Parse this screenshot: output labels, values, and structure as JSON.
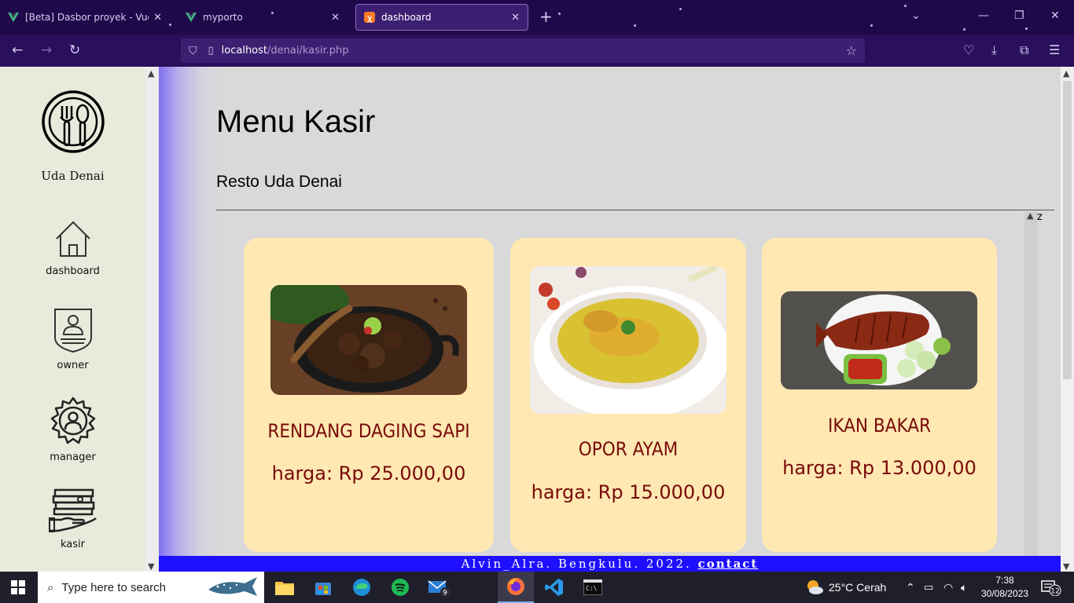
{
  "browser": {
    "tabs": [
      {
        "label": "[Beta] Dasbor proyek - Vue CLI",
        "favicon": "vue-icon"
      },
      {
        "label": "myporto",
        "favicon": "vue-icon"
      },
      {
        "label": "dashboard",
        "favicon": "xampp-icon",
        "active": true
      }
    ],
    "url_host": "localhost",
    "url_path": "/denai/kasir.php"
  },
  "sidebar": {
    "brand": "Uda Denai",
    "items": [
      {
        "label": "dashboard",
        "icon": "home-icon"
      },
      {
        "label": "owner",
        "icon": "owner-badge-icon"
      },
      {
        "label": "manager",
        "icon": "gear-user-icon"
      },
      {
        "label": "kasir",
        "icon": "money-hand-icon"
      }
    ]
  },
  "main": {
    "title": "Menu Kasir",
    "subtitle": "Resto Uda Denai",
    "stray_label": "z",
    "menu": [
      {
        "name": "RENDANG DAGING SAPI",
        "price": "harga: Rp 25.000,00",
        "image": "rendang-photo"
      },
      {
        "name": "OPOR AYAM",
        "price": "harga: Rp 15.000,00",
        "image": "opor-ayam-photo"
      },
      {
        "name": "IKAN BAKAR",
        "price": "harga: Rp 13.000,00",
        "image": "ikan-bakar-photo"
      }
    ]
  },
  "footer": {
    "text": "Alvin_Alra. Bengkulu. 2022.",
    "link": "contact"
  },
  "taskbar": {
    "search_placeholder": "Type here to search",
    "weather": "25°C  Cerah",
    "time": "7:38",
    "date": "30/08/2023",
    "mail_badge": "9",
    "notification_count": "12"
  },
  "colors": {
    "chrome_bg": "#20094a",
    "urlbar_bg": "#3d1f72",
    "sidebar_bg": "#e9e9dc",
    "main_bg": "#d9d9d9",
    "card_bg": "#ffe8b2",
    "card_text": "#7a0a0a",
    "footer_bg": "#1e10ff"
  }
}
